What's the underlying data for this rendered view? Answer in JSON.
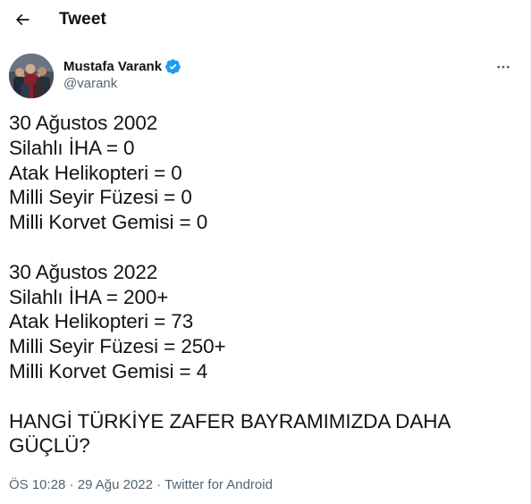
{
  "header": {
    "back_icon": "arrow-left-icon",
    "title": "Tweet"
  },
  "author": {
    "display_name": "Mustafa Varank",
    "handle": "@varank",
    "verified_icon": "verified-badge-icon",
    "verified_color": "#1d9bf0",
    "more_icon": "more-horizontal-icon"
  },
  "tweet": {
    "block_2002": [
      "30 Ağustos 2002",
      "Silahlı İHA = 0",
      "Atak Helikopteri = 0",
      "Milli Seyir Füzesi = 0",
      "Milli Korvet Gemisi = 0"
    ],
    "block_2022": [
      "30 Ağustos 2022",
      "Silahlı İHA = 200+",
      "Atak Helikopteri = 73",
      "Milli Seyir Füzesi = 250+",
      "Milli Korvet Gemisi = 4"
    ],
    "question": [
      "HANGİ TÜRKİYE ZAFER BAYRAMIMIZDA DAHA",
      "GÜÇLÜ?"
    ]
  },
  "meta": {
    "time": "ÖS 10:28",
    "separator": " · ",
    "date": "29 Ağu 2022",
    "client": "Twitter for Android"
  },
  "colors": {
    "text": "#0f1419",
    "secondary": "#536471",
    "accent": "#1d9bf0"
  }
}
